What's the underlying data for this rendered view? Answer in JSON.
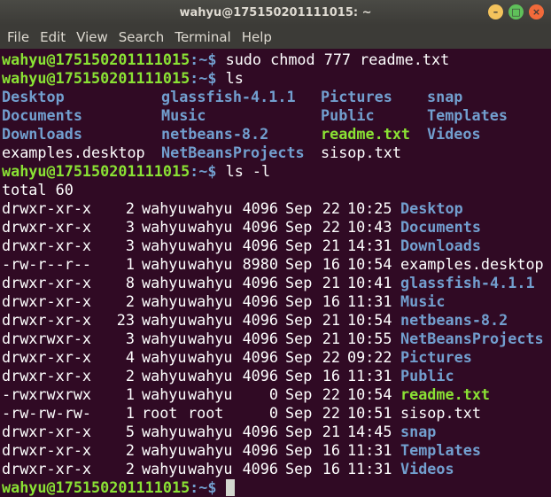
{
  "window": {
    "title": "wahyu@175150201111015: ~"
  },
  "menu": [
    "File",
    "Edit",
    "View",
    "Search",
    "Terminal",
    "Help"
  ],
  "prompt": {
    "user": "wahyu@175150201111015",
    "sep": ":~$ "
  },
  "commands": [
    "sudo chmod 777 readme.txt",
    "ls",
    "ls -l"
  ],
  "ls_grid": [
    [
      "Desktop",
      "glassfish-4.1.1",
      "Pictures",
      "snap"
    ],
    [
      "Documents",
      "Music",
      "Public",
      "Templates"
    ],
    [
      "Downloads",
      "netbeans-8.2",
      "readme.txt",
      "Videos"
    ],
    [
      "examples.desktop",
      "NetBeansProjects",
      "sisop.txt",
      ""
    ]
  ],
  "total": "total 60",
  "ls_long": [
    [
      "drwxr-xr-x",
      "2",
      "wahyu",
      "wahyu",
      "4096",
      "Sep",
      "22",
      "10:25",
      "Desktop"
    ],
    [
      "drwxr-xr-x",
      "3",
      "wahyu",
      "wahyu",
      "4096",
      "Sep",
      "22",
      "10:43",
      "Documents"
    ],
    [
      "drwxr-xr-x",
      "3",
      "wahyu",
      "wahyu",
      "4096",
      "Sep",
      "21",
      "14:31",
      "Downloads"
    ],
    [
      "-rw-r--r--",
      "1",
      "wahyu",
      "wahyu",
      "8980",
      "Sep",
      "16",
      "10:54",
      "examples.desktop"
    ],
    [
      "drwxr-xr-x",
      "8",
      "wahyu",
      "wahyu",
      "4096",
      "Sep",
      "21",
      "10:41",
      "glassfish-4.1.1"
    ],
    [
      "drwxr-xr-x",
      "2",
      "wahyu",
      "wahyu",
      "4096",
      "Sep",
      "16",
      "11:31",
      "Music"
    ],
    [
      "drwxr-xr-x",
      "23",
      "wahyu",
      "wahyu",
      "4096",
      "Sep",
      "21",
      "10:54",
      "netbeans-8.2"
    ],
    [
      "drwxrwxr-x",
      "3",
      "wahyu",
      "wahyu",
      "4096",
      "Sep",
      "21",
      "10:55",
      "NetBeansProjects"
    ],
    [
      "drwxr-xr-x",
      "4",
      "wahyu",
      "wahyu",
      "4096",
      "Sep",
      "22",
      "09:22",
      "Pictures"
    ],
    [
      "drwxr-xr-x",
      "2",
      "wahyu",
      "wahyu",
      "4096",
      "Sep",
      "16",
      "11:31",
      "Public"
    ],
    [
      "-rwxrwxrwx",
      "1",
      "wahyu",
      "wahyu",
      "0",
      "Sep",
      "22",
      "10:54",
      "readme.txt"
    ],
    [
      "-rw-rw-rw-",
      "1",
      "root",
      "root",
      "0",
      "Sep",
      "22",
      "10:51",
      "sisop.txt"
    ],
    [
      "drwxr-xr-x",
      "5",
      "wahyu",
      "wahyu",
      "4096",
      "Sep",
      "21",
      "14:45",
      "snap"
    ],
    [
      "drwxr-xr-x",
      "2",
      "wahyu",
      "wahyu",
      "4096",
      "Sep",
      "16",
      "11:31",
      "Templates"
    ],
    [
      "drwxr-xr-x",
      "2",
      "wahyu",
      "wahyu",
      "4096",
      "Sep",
      "16",
      "11:31",
      "Videos"
    ]
  ]
}
